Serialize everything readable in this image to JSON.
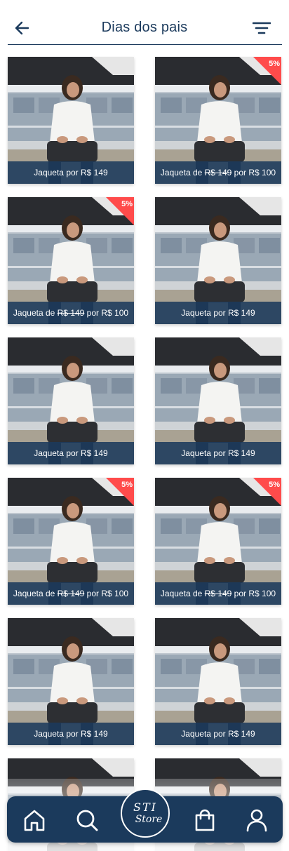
{
  "header": {
    "title": "Dias dos pais",
    "back_icon": "arrow-left-icon",
    "filter_icon": "filter-icon"
  },
  "colors": {
    "primary": "#1b3a5c",
    "badge": "#ff4b4b",
    "background": "#ffffff"
  },
  "products": [
    {
      "caption": "Jaqueta por R$ 149",
      "discount": ""
    },
    {
      "caption_prefix": "Jaqueta de ",
      "old_price": "R$ 149",
      "caption_suffix": " por R$ 100",
      "discount": "5%"
    },
    {
      "caption_prefix": "Jaqueta de ",
      "old_price": "R$ 149",
      "caption_suffix": " por R$ 100",
      "discount": "5%"
    },
    {
      "caption": "Jaqueta por R$ 149",
      "discount": ""
    },
    {
      "caption": "Jaqueta por R$ 149",
      "discount": ""
    },
    {
      "caption": "Jaqueta por R$ 149",
      "discount": ""
    },
    {
      "caption_prefix": "Jaqueta de ",
      "old_price": "R$ 149",
      "caption_suffix": " por R$ 100",
      "discount": "5%"
    },
    {
      "caption_prefix": "Jaqueta de ",
      "old_price": "R$ 149",
      "caption_suffix": " por R$ 100",
      "discount": "5%"
    },
    {
      "caption": "Jaqueta por R$ 149",
      "discount": ""
    },
    {
      "caption": "Jaqueta por R$ 149",
      "discount": ""
    },
    {
      "caption": "",
      "discount": ""
    },
    {
      "caption": "",
      "discount": ""
    }
  ],
  "nav": {
    "home_icon": "home-icon",
    "search_icon": "search-icon",
    "logo_line1": "STI",
    "logo_line2": "Store",
    "bag_icon": "shopping-bag-icon",
    "profile_icon": "user-icon"
  }
}
